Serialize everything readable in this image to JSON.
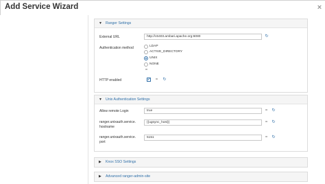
{
  "window": {
    "title": "Add Service Wizard"
  },
  "ranger_settings": {
    "header": "Ranger Settings",
    "external_url_label": "External URL",
    "external_url_value": "http://c6403.ambari.apache.org:6080",
    "auth_method_label": "Authentication method",
    "auth_options": [
      "LDAP",
      "ACTIVE_DIRECTORY",
      "UNIX",
      "NONE"
    ],
    "auth_selected": "UNIX",
    "http_enabled_label": "HTTP enabled",
    "http_enabled": true
  },
  "unix_auth": {
    "header": "Unix Authentication Settings",
    "allow_remote_login_label": "Allow remote Login",
    "allow_remote_login_value": "true",
    "hostname_label_line1": "ranger.unixauth.service.",
    "hostname_label_line2": "hostname",
    "hostname_value": "{{ugsync_host}}",
    "port_label_line1": "ranger.unixauth.service.",
    "port_label_line2": "port",
    "port_value": "5151"
  },
  "knox_sso": {
    "header": "Knox SSO Settings"
  },
  "advanced_admin_site": {
    "header": "Advanced ranger-admin-site"
  },
  "icons": {
    "caret_expanded": "▼",
    "caret_collapsed": "▶",
    "refresh": "↻",
    "equals": "=",
    "check": "✔",
    "close": "×"
  },
  "colors": {
    "link": "#2f6fa8"
  }
}
